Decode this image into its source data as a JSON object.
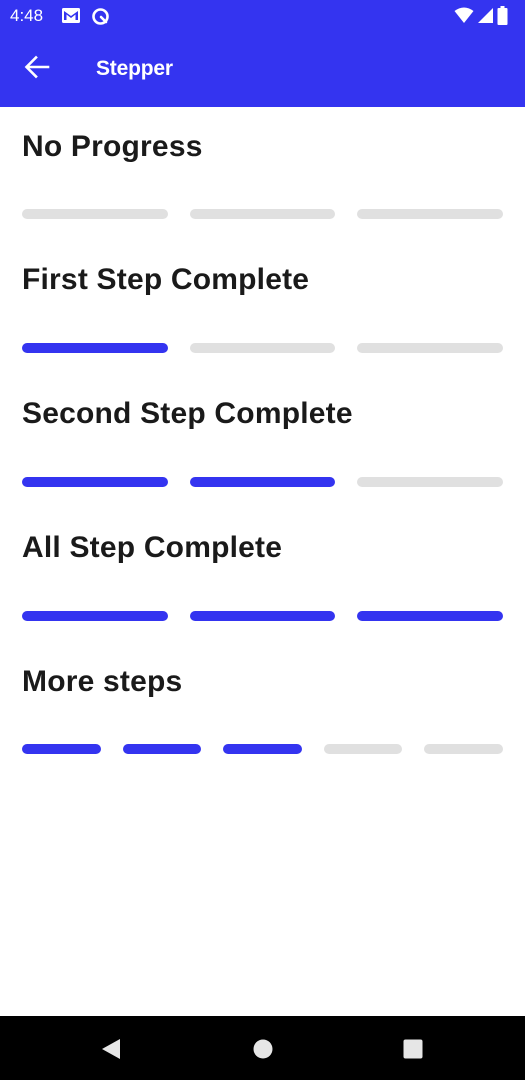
{
  "status_bar": {
    "time": "4:48",
    "icons": [
      "gmail-icon",
      "app-notification-icon",
      "wifi-icon",
      "signal-icon",
      "battery-icon"
    ]
  },
  "app_bar": {
    "title": "Stepper",
    "back_icon": "arrow-back-icon",
    "background": "#3434f0"
  },
  "colors": {
    "accent": "#3434f0",
    "inactive_step": "#e0e0e0",
    "text": "#1a1a1a"
  },
  "sections": [
    {
      "title": "No Progress",
      "total_steps": 3,
      "completed_steps": 0
    },
    {
      "title": "First Step Complete",
      "total_steps": 3,
      "completed_steps": 1
    },
    {
      "title": "Second Step Complete",
      "total_steps": 3,
      "completed_steps": 2
    },
    {
      "title": "All Step Complete",
      "total_steps": 3,
      "completed_steps": 3
    },
    {
      "title": "More steps",
      "total_steps": 5,
      "completed_steps": 3
    }
  ],
  "nav_bar": {
    "buttons": [
      "nav-back-icon",
      "nav-home-icon",
      "nav-recents-icon"
    ]
  }
}
